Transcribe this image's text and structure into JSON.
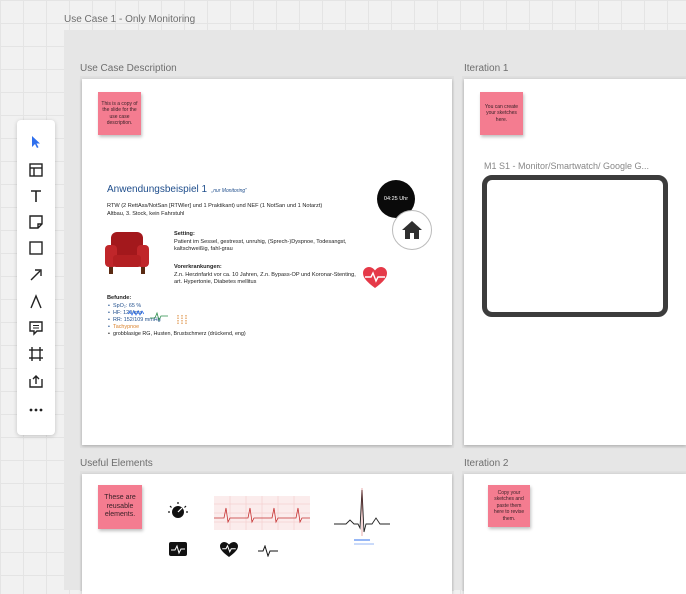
{
  "board": {
    "outer_frame_title": "Use Case 1 - Only Monitoring"
  },
  "frames": {
    "use_case_description": "Use Case Description",
    "iteration_1": "Iteration 1",
    "useful_elements": "Useful Elements",
    "iteration_2": "Iteration 2"
  },
  "stickies": {
    "copy_note": "This is a copy of the slide for the use case description.",
    "iteration1_note": "You can create your sketches here.",
    "useful_note": "These are reusable elements.",
    "iteration2_note": "Copy your sketches and paste them here to revise them."
  },
  "slide": {
    "title": "Anwendungsbeispiel 1",
    "title_suffix": "„nur Monitoring“",
    "line1": "RTW (2 RettAss/NotSan [RTWler] und 1 Praktikant) und NEF (1 NotSan und 1 Notarzt)",
    "line2": "Altbau, 3. Stock, kein Fahrstuhl",
    "clock": "04:25 Uhr",
    "setting_heading": "Setting:",
    "setting_text": "Patient im Sessel, gestresst, unruhig, (Sprech-)Dyspnoe, Todesangst, kaltschweißig, fahl-grau",
    "vor_heading": "Vorerkrankungen:",
    "vor_text": "Z.n. Herzinfarkt vor ca. 10 Jahren, Z.n. Bypass-OP und Koronar-Stenting, art. Hypertonie, Diabetes mellitus",
    "befunde_heading": "Befunde:",
    "vitals": [
      {
        "label": "SpO₂: 65 %",
        "color": "#1f4e8c"
      },
      {
        "label": "HF: 120/min",
        "color": "#1f4e8c"
      },
      {
        "label": "RR: 152/109 mmHg",
        "color": "#1f4e8c"
      },
      {
        "label": "Tachypnoe",
        "color": "#d9822b"
      },
      {
        "label": "grobblasige RG, Husten, Brustschmerz (drückend, eng)",
        "color": "#222222"
      }
    ]
  },
  "iteration1": {
    "sketch_label": "M1 S1 - Monitor/Smartwatch/ Google G..."
  },
  "toolbar": {
    "tools": [
      "select-icon",
      "template-icon",
      "text-icon",
      "sticky-note-icon",
      "shape-icon",
      "connector-icon",
      "pen-icon",
      "comment-icon",
      "frame-icon",
      "upload-icon",
      "more-icon"
    ]
  },
  "colors": {
    "sticky": "#f47c90",
    "accent": "#2f6fed",
    "heart": "#e53948"
  }
}
